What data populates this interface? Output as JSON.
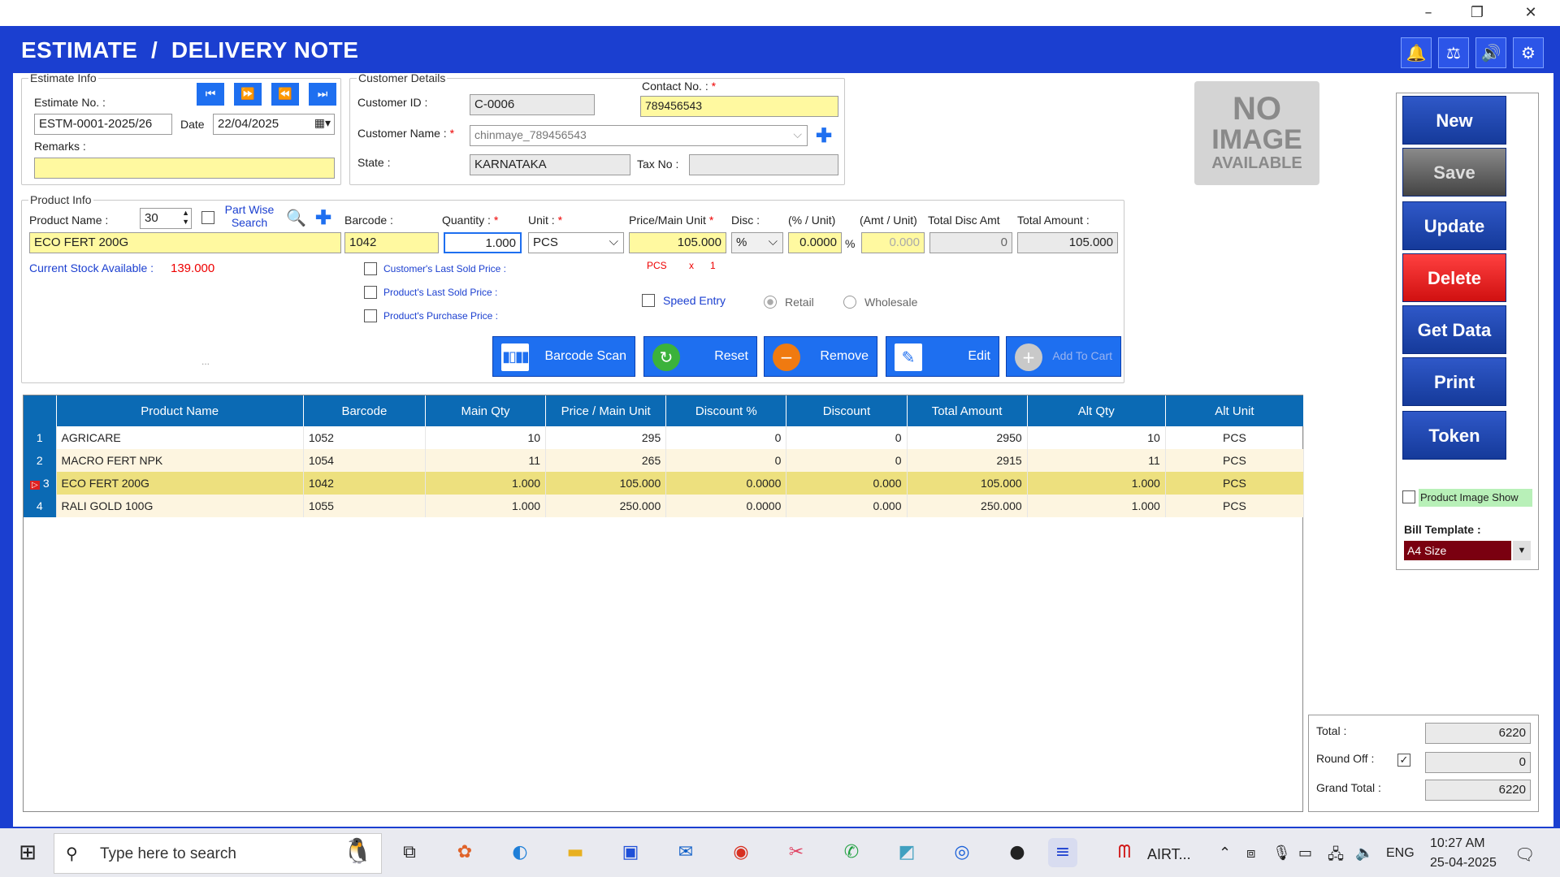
{
  "header": {
    "title": "ESTIMATE  /  DELIVERY NOTE"
  },
  "estimate": {
    "legend": "Estimate Info",
    "no_label": "Estimate No. :",
    "no_value": "ESTM-0001-2025/26",
    "date_label": "Date",
    "date_value": "22/04/2025",
    "remarks_label": "Remarks :"
  },
  "customer": {
    "legend": "Customer Details",
    "id_label": "Customer ID :",
    "id_value": "C-0006",
    "contact_label": "Contact No. :",
    "contact_value": "789456543",
    "name_label": "Customer Name :",
    "name_value": "chinmaye_789456543",
    "state_label": "State :",
    "state_value": "KARNATAKA",
    "tax_label": "Tax No :"
  },
  "no_image": {
    "line1": "NO",
    "line2": "IMAGE",
    "line3": "AVAILABLE"
  },
  "product": {
    "legend": "Product Info",
    "name_label": "Product Name :",
    "spin_value": "30",
    "part_wise": "Part Wise Search",
    "barcode_label": "Barcode :",
    "quantity_label": "Quantity :",
    "unit_label": "Unit :",
    "price_label": "Price/Main Unit",
    "disc_label": "Disc :",
    "pct_unit_label": "(% / Unit)",
    "amt_unit_label": "(Amt / Unit)",
    "total_disc_label": "Total Disc Amt",
    "total_amount_label": "Total Amount :",
    "name_value": "ECO FERT 200G",
    "barcode_value": "1042",
    "quantity_value": "1.000",
    "unit_value": "PCS",
    "price_value": "105.000",
    "disc_type": "%",
    "pct_value": "0.0000",
    "pct_sign": "%",
    "amt_value": "0.000",
    "total_disc_value": "0",
    "total_amount_value": "105.000",
    "stock_label": "Current Stock Available :",
    "stock_value": "139.000",
    "unit_conv_unit": "PCS",
    "unit_conv_x": "x",
    "unit_conv_qty": "1",
    "cust_last_price": "Customer's Last Sold Price :",
    "prod_last_price": "Product's Last Sold Price :",
    "prod_purchase_price": "Product's Purchase Price :",
    "speed_entry": "Speed Entry",
    "retail": "Retail",
    "wholesale": "Wholesale",
    "dots": "..."
  },
  "actions": {
    "barcode_scan": "Barcode Scan",
    "reset": "Reset",
    "remove": "Remove",
    "edit": "Edit",
    "add_to_cart": "Add To Cart"
  },
  "side": {
    "new": "New",
    "save": "Save",
    "update": "Update",
    "delete": "Delete",
    "get_data": "Get Data",
    "print": "Print",
    "token": "Token",
    "image_show": "Product Image Show",
    "bill_template_label": "Bill Template :",
    "bill_template_value": "A4 Size"
  },
  "grid": {
    "columns": [
      "Product Name",
      "Barcode",
      "Main Qty",
      "Price / Main Unit",
      "Discount %",
      "Discount",
      "Total Amount",
      "Alt Qty",
      "Alt Unit"
    ],
    "rows": [
      [
        "1",
        "AGRICARE",
        "1052",
        "10",
        "295",
        "0",
        "0",
        "2950",
        "10",
        "PCS"
      ],
      [
        "2",
        "MACRO FERT NPK",
        "1054",
        "11",
        "265",
        "0",
        "0",
        "2915",
        "11",
        "PCS"
      ],
      [
        "3",
        "ECO FERT 200G",
        "1042",
        "1.000",
        "105.000",
        "0.0000",
        "0.000",
        "105.000",
        "1.000",
        "PCS"
      ],
      [
        "4",
        "RALI GOLD 100G",
        "1055",
        "1.000",
        "250.000",
        "0.0000",
        "0.000",
        "250.000",
        "1.000",
        "PCS"
      ]
    ],
    "selected_row": 2
  },
  "totals": {
    "total_label": "Total :",
    "total_value": "6220",
    "round_label": "Round Off :",
    "round_value": "0",
    "grand_label": "Grand Total :",
    "grand_value": "6220"
  },
  "taskbar": {
    "search_placeholder": "Type here to search",
    "airtel": "AIRT...",
    "lang": "ENG",
    "time": "10:27 AM",
    "date": "25-04-2025"
  },
  "colors": {
    "primary": "#1b3fd0",
    "delete": "#e01818",
    "grid_header": "#0b6ab4",
    "selected_row": "#ede07e"
  }
}
